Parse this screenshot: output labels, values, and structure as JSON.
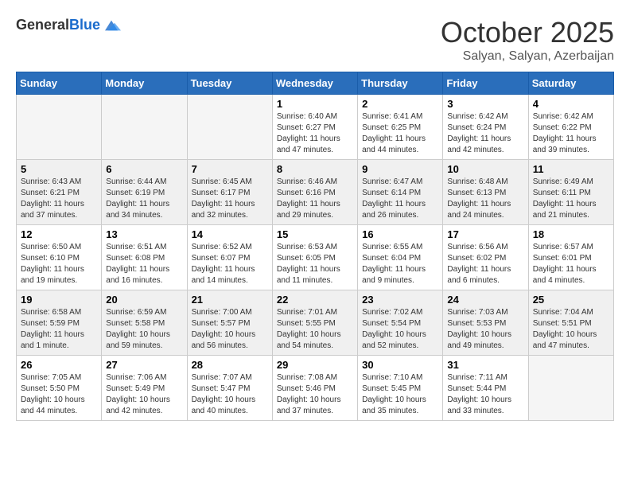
{
  "logo": {
    "general": "General",
    "blue": "Blue"
  },
  "title": "October 2025",
  "location": "Salyan, Salyan, Azerbaijan",
  "weekdays": [
    "Sunday",
    "Monday",
    "Tuesday",
    "Wednesday",
    "Thursday",
    "Friday",
    "Saturday"
  ],
  "weeks": [
    [
      {
        "day": "",
        "sunrise": "",
        "sunset": "",
        "daylight": ""
      },
      {
        "day": "",
        "sunrise": "",
        "sunset": "",
        "daylight": ""
      },
      {
        "day": "",
        "sunrise": "",
        "sunset": "",
        "daylight": ""
      },
      {
        "day": "1",
        "sunrise": "Sunrise: 6:40 AM",
        "sunset": "Sunset: 6:27 PM",
        "daylight": "Daylight: 11 hours and 47 minutes."
      },
      {
        "day": "2",
        "sunrise": "Sunrise: 6:41 AM",
        "sunset": "Sunset: 6:25 PM",
        "daylight": "Daylight: 11 hours and 44 minutes."
      },
      {
        "day": "3",
        "sunrise": "Sunrise: 6:42 AM",
        "sunset": "Sunset: 6:24 PM",
        "daylight": "Daylight: 11 hours and 42 minutes."
      },
      {
        "day": "4",
        "sunrise": "Sunrise: 6:42 AM",
        "sunset": "Sunset: 6:22 PM",
        "daylight": "Daylight: 11 hours and 39 minutes."
      }
    ],
    [
      {
        "day": "5",
        "sunrise": "Sunrise: 6:43 AM",
        "sunset": "Sunset: 6:21 PM",
        "daylight": "Daylight: 11 hours and 37 minutes."
      },
      {
        "day": "6",
        "sunrise": "Sunrise: 6:44 AM",
        "sunset": "Sunset: 6:19 PM",
        "daylight": "Daylight: 11 hours and 34 minutes."
      },
      {
        "day": "7",
        "sunrise": "Sunrise: 6:45 AM",
        "sunset": "Sunset: 6:17 PM",
        "daylight": "Daylight: 11 hours and 32 minutes."
      },
      {
        "day": "8",
        "sunrise": "Sunrise: 6:46 AM",
        "sunset": "Sunset: 6:16 PM",
        "daylight": "Daylight: 11 hours and 29 minutes."
      },
      {
        "day": "9",
        "sunrise": "Sunrise: 6:47 AM",
        "sunset": "Sunset: 6:14 PM",
        "daylight": "Daylight: 11 hours and 26 minutes."
      },
      {
        "day": "10",
        "sunrise": "Sunrise: 6:48 AM",
        "sunset": "Sunset: 6:13 PM",
        "daylight": "Daylight: 11 hours and 24 minutes."
      },
      {
        "day": "11",
        "sunrise": "Sunrise: 6:49 AM",
        "sunset": "Sunset: 6:11 PM",
        "daylight": "Daylight: 11 hours and 21 minutes."
      }
    ],
    [
      {
        "day": "12",
        "sunrise": "Sunrise: 6:50 AM",
        "sunset": "Sunset: 6:10 PM",
        "daylight": "Daylight: 11 hours and 19 minutes."
      },
      {
        "day": "13",
        "sunrise": "Sunrise: 6:51 AM",
        "sunset": "Sunset: 6:08 PM",
        "daylight": "Daylight: 11 hours and 16 minutes."
      },
      {
        "day": "14",
        "sunrise": "Sunrise: 6:52 AM",
        "sunset": "Sunset: 6:07 PM",
        "daylight": "Daylight: 11 hours and 14 minutes."
      },
      {
        "day": "15",
        "sunrise": "Sunrise: 6:53 AM",
        "sunset": "Sunset: 6:05 PM",
        "daylight": "Daylight: 11 hours and 11 minutes."
      },
      {
        "day": "16",
        "sunrise": "Sunrise: 6:55 AM",
        "sunset": "Sunset: 6:04 PM",
        "daylight": "Daylight: 11 hours and 9 minutes."
      },
      {
        "day": "17",
        "sunrise": "Sunrise: 6:56 AM",
        "sunset": "Sunset: 6:02 PM",
        "daylight": "Daylight: 11 hours and 6 minutes."
      },
      {
        "day": "18",
        "sunrise": "Sunrise: 6:57 AM",
        "sunset": "Sunset: 6:01 PM",
        "daylight": "Daylight: 11 hours and 4 minutes."
      }
    ],
    [
      {
        "day": "19",
        "sunrise": "Sunrise: 6:58 AM",
        "sunset": "Sunset: 5:59 PM",
        "daylight": "Daylight: 11 hours and 1 minute."
      },
      {
        "day": "20",
        "sunrise": "Sunrise: 6:59 AM",
        "sunset": "Sunset: 5:58 PM",
        "daylight": "Daylight: 10 hours and 59 minutes."
      },
      {
        "day": "21",
        "sunrise": "Sunrise: 7:00 AM",
        "sunset": "Sunset: 5:57 PM",
        "daylight": "Daylight: 10 hours and 56 minutes."
      },
      {
        "day": "22",
        "sunrise": "Sunrise: 7:01 AM",
        "sunset": "Sunset: 5:55 PM",
        "daylight": "Daylight: 10 hours and 54 minutes."
      },
      {
        "day": "23",
        "sunrise": "Sunrise: 7:02 AM",
        "sunset": "Sunset: 5:54 PM",
        "daylight": "Daylight: 10 hours and 52 minutes."
      },
      {
        "day": "24",
        "sunrise": "Sunrise: 7:03 AM",
        "sunset": "Sunset: 5:53 PM",
        "daylight": "Daylight: 10 hours and 49 minutes."
      },
      {
        "day": "25",
        "sunrise": "Sunrise: 7:04 AM",
        "sunset": "Sunset: 5:51 PM",
        "daylight": "Daylight: 10 hours and 47 minutes."
      }
    ],
    [
      {
        "day": "26",
        "sunrise": "Sunrise: 7:05 AM",
        "sunset": "Sunset: 5:50 PM",
        "daylight": "Daylight: 10 hours and 44 minutes."
      },
      {
        "day": "27",
        "sunrise": "Sunrise: 7:06 AM",
        "sunset": "Sunset: 5:49 PM",
        "daylight": "Daylight: 10 hours and 42 minutes."
      },
      {
        "day": "28",
        "sunrise": "Sunrise: 7:07 AM",
        "sunset": "Sunset: 5:47 PM",
        "daylight": "Daylight: 10 hours and 40 minutes."
      },
      {
        "day": "29",
        "sunrise": "Sunrise: 7:08 AM",
        "sunset": "Sunset: 5:46 PM",
        "daylight": "Daylight: 10 hours and 37 minutes."
      },
      {
        "day": "30",
        "sunrise": "Sunrise: 7:10 AM",
        "sunset": "Sunset: 5:45 PM",
        "daylight": "Daylight: 10 hours and 35 minutes."
      },
      {
        "day": "31",
        "sunrise": "Sunrise: 7:11 AM",
        "sunset": "Sunset: 5:44 PM",
        "daylight": "Daylight: 10 hours and 33 minutes."
      },
      {
        "day": "",
        "sunrise": "",
        "sunset": "",
        "daylight": ""
      }
    ]
  ]
}
